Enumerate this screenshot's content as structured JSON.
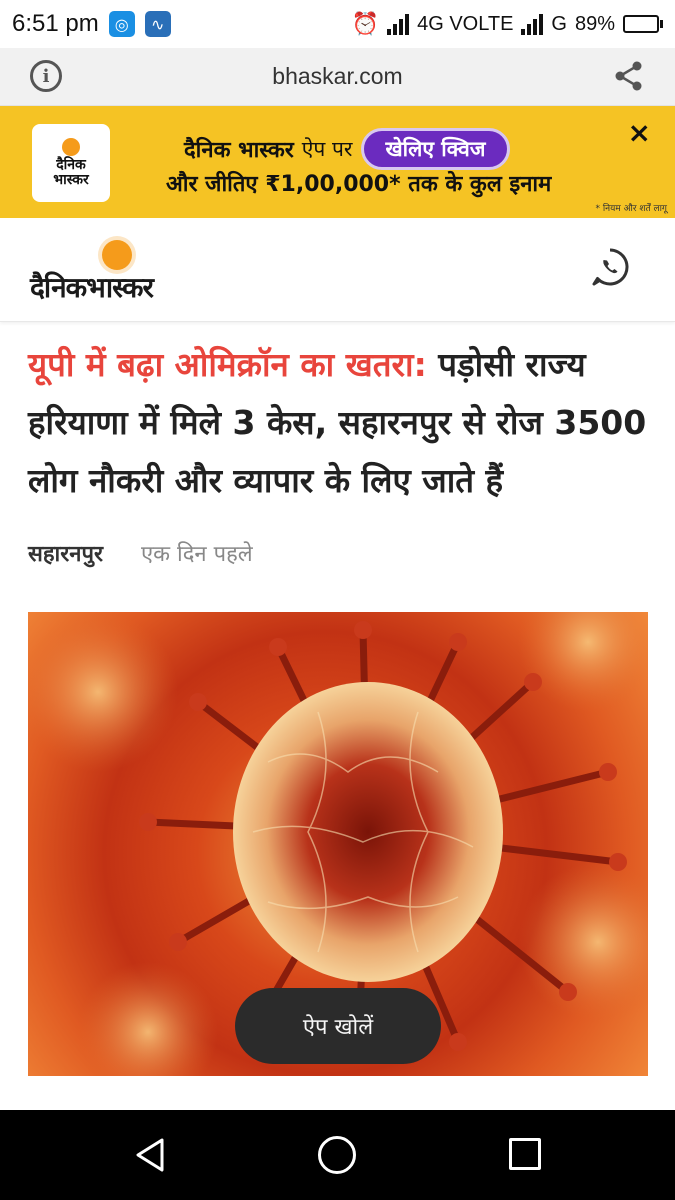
{
  "status_bar": {
    "time": "6:51 pm",
    "network_1": "4G VOLTE",
    "network_2": "G",
    "battery_percent": "89%",
    "battery_level": 0.89
  },
  "browser": {
    "url": "bhaskar.com"
  },
  "promo": {
    "logo_text_1": "दैनिक",
    "logo_text_2": "भास्कर",
    "brand": "दैनिक भास्कर",
    "text_1": "ऐप पर",
    "button_label": "खेलिए क्विज",
    "line_2": "और जीतिए ₹1,00,000* तक के कुल इनाम",
    "disclaimer": "* नियम और शर्तें लागू",
    "close_symbol": "×",
    "accent_color": "#6b2bbf",
    "background_color": "#f5c324"
  },
  "header": {
    "brand_name": "दैनिकभास्कर"
  },
  "article": {
    "headline_accent": "यूपी में बढ़ा ओमिक्रॉन का खतरा:",
    "headline_rest": " पड़ोसी राज्य हरियाणा में मिले 3 केस, सहारनपुर से रोज 3500 लोग नौकरी और व्यापार के लिए जाते हैं",
    "location": "सहारनपुर",
    "published": "एक दिन पहले",
    "accent_color": "#e8453c"
  },
  "floating": {
    "open_app_label": "ऐप खोलें"
  },
  "nav": {
    "back": "back-icon",
    "home": "home-icon",
    "recents": "recents-icon"
  }
}
